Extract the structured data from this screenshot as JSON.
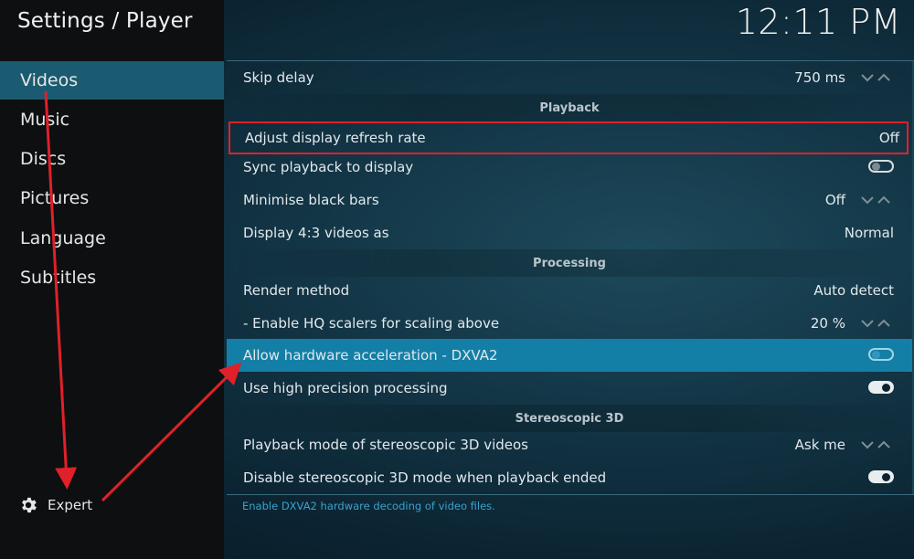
{
  "header": {
    "title": "Settings / Player",
    "clock": "12:11 PM"
  },
  "sidebar": {
    "items": [
      {
        "label": "Videos",
        "active": true
      },
      {
        "label": "Music",
        "active": false
      },
      {
        "label": "Discs",
        "active": false
      },
      {
        "label": "Pictures",
        "active": false
      },
      {
        "label": "Language",
        "active": false
      },
      {
        "label": "Subtitles",
        "active": false
      }
    ],
    "expert_label": "Expert"
  },
  "settings": {
    "skip_delay": {
      "label": "Skip delay",
      "value": "750 ms"
    },
    "section_playback": "Playback",
    "adjust_refresh": {
      "label": "Adjust display refresh rate",
      "value": "Off"
    },
    "sync_playback": {
      "label": "Sync playback to display",
      "toggle": "off"
    },
    "minimise_black_bars": {
      "label": "Minimise black bars",
      "value": "Off"
    },
    "display_43": {
      "label": "Display 4:3 videos as",
      "value": "Normal"
    },
    "section_processing": "Processing",
    "render_method": {
      "label": "Render method",
      "value": "Auto detect"
    },
    "hq_scalers": {
      "label": "- Enable HQ scalers for scaling above",
      "value": "20 %"
    },
    "hw_accel": {
      "label": "Allow hardware acceleration - DXVA2",
      "toggle": "off"
    },
    "high_precision": {
      "label": "Use high precision processing",
      "toggle": "on"
    },
    "section_stereo": "Stereoscopic 3D",
    "stereo_mode": {
      "label": "Playback mode of stereoscopic 3D videos",
      "value": "Ask me"
    },
    "disable_stereo": {
      "label": "Disable stereoscopic 3D mode when playback ended",
      "toggle": "on"
    }
  },
  "description": "Enable DXVA2 hardware decoding of video files.",
  "colors": {
    "focus": "#147fa6",
    "active_nav": "#1b5b71",
    "annotation": "#e0202a"
  },
  "icons": {
    "expert": "gear-icon",
    "spin": "chevron-up-down-icon"
  }
}
